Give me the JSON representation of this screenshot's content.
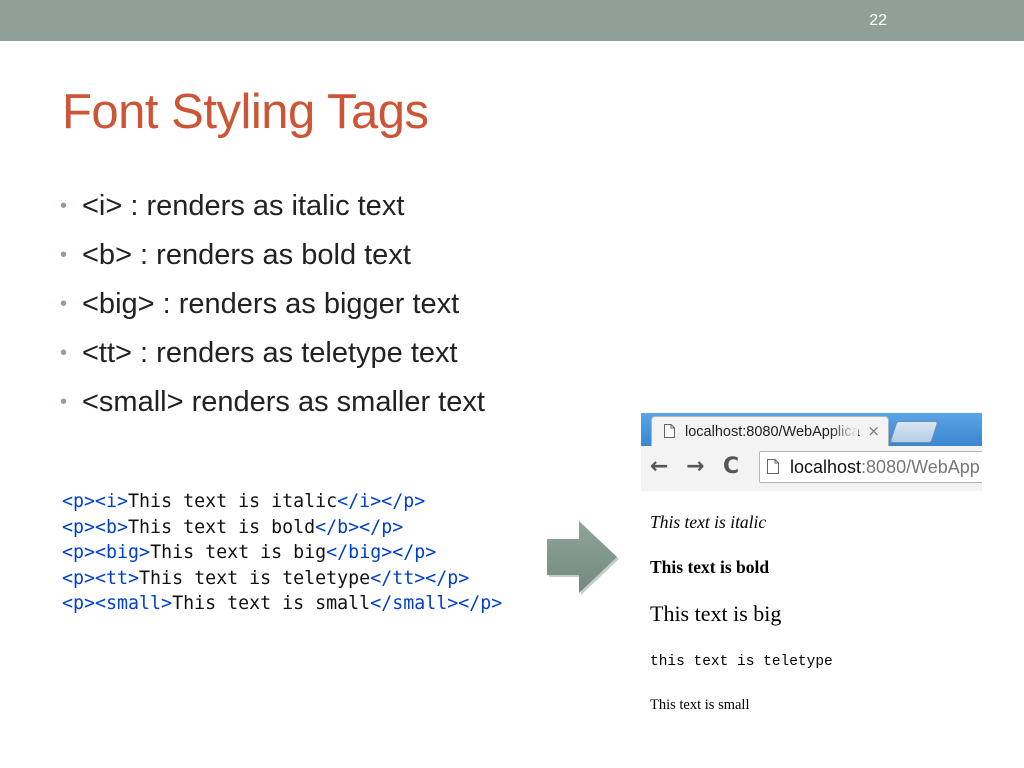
{
  "slide": {
    "page_number": "22",
    "title": "Font Styling Tags",
    "accent_color": "#cc5535",
    "bar_color": "#8fa098"
  },
  "bullets": [
    {
      "bullet": "•",
      "text": "<i> : renders as italic text"
    },
    {
      "bullet": "•",
      "text": "<b> : renders as bold text"
    },
    {
      "bullet": "•",
      "text": "<big> : renders as bigger text"
    },
    {
      "bullet": "•",
      "text": "<tt> : renders as teletype text"
    },
    {
      "bullet": "•",
      "text": "<small> renders as smaller text"
    }
  ],
  "code": [
    {
      "open": "<p><i>",
      "text": "This text is italic",
      "close": "</i></p>"
    },
    {
      "open": "<p><b>",
      "text": "This text is bold",
      "close": "</b></p>"
    },
    {
      "open": "<p><big>",
      "text": "This text is big",
      "close": "</big></p>"
    },
    {
      "open": "<p><tt>",
      "text": "This text is teletype",
      "close": "</tt></p>"
    },
    {
      "open": "<p><small>",
      "text": "This text is small",
      "close": "</small></p>"
    }
  ],
  "arrow": {
    "icon": "right-arrow-icon",
    "color": "#7f958b"
  },
  "browser": {
    "tab_title": "localhost:8080/WebApplica",
    "tab_close": "×",
    "icons": {
      "back": "back-arrow-icon",
      "forward": "forward-arrow-icon",
      "reload": "reload-icon",
      "page": "page-icon"
    },
    "nav": {
      "back": "←",
      "forward": "→",
      "reload": "C"
    },
    "url_host": "localhost",
    "url_rest": ":8080/WebApp",
    "rendered": {
      "italic": "This text is italic",
      "bold": "This text is bold",
      "big": "This text is big",
      "teletype": "this text is teletype",
      "small": "This text is small"
    }
  }
}
